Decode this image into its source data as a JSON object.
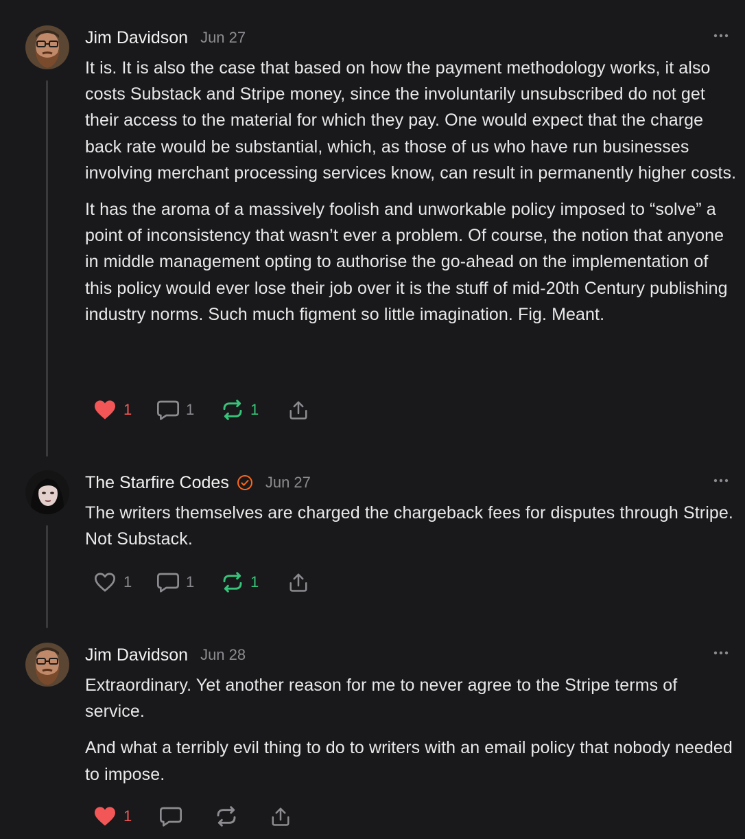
{
  "comments": [
    {
      "author": "Jim Davidson",
      "date": "Jun 27",
      "verified": false,
      "avatar": "bearded-man-avatar",
      "paragraphs": [
        "It is. It is also the case that based on how the payment methodology works, it also costs Substack and Stripe money, since the involuntarily unsubscribed do not get their access to the material for which they pay. One would expect that the charge back rate would be substantial, which, as those of us who have run businesses involving merchant processing services know, can result in permanently higher costs.",
        "It has the aroma of a massively foolish and unworkable policy imposed to “solve” a point of inconsistency that wasn’t ever a problem. Of course, the notion that anyone in middle management opting to authorise the go-ahead on the implementation of this policy would ever lose their job over it is the stuff of mid-20th Century publishing industry norms. Such much figment so little imagination. Fig. Meant."
      ],
      "actions": {
        "like_count": "1",
        "liked": true,
        "reply_count": "1",
        "restack_count": "1",
        "restacked": true
      }
    },
    {
      "author": "The Starfire Codes",
      "date": "Jun 27",
      "verified": true,
      "avatar": "dark-haired-woman-avatar",
      "paragraphs": [
        "The writers themselves are charged the chargeback fees for disputes through Stripe. Not Substack."
      ],
      "actions": {
        "like_count": "1",
        "liked": false,
        "reply_count": "1",
        "restack_count": "1",
        "restacked": true
      }
    },
    {
      "author": "Jim Davidson",
      "date": "Jun 28",
      "verified": false,
      "avatar": "bearded-man-avatar",
      "paragraphs": [
        "Extraordinary. Yet another reason for me to never agree to the Stripe terms of service.",
        "And what a terribly evil thing to do to writers with an email policy that nobody needed to impose."
      ],
      "actions": {
        "like_count": "1",
        "liked": true,
        "reply_count": "",
        "restack_count": "",
        "restacked": false
      }
    }
  ],
  "colors": {
    "background": "#19191b",
    "text": "#e9e9ea",
    "muted": "#8c8c90",
    "like_red": "#f25656",
    "restack_green": "#37c47a",
    "verified_orange": "#ff6719",
    "thread_line": "#3a3a3d"
  }
}
